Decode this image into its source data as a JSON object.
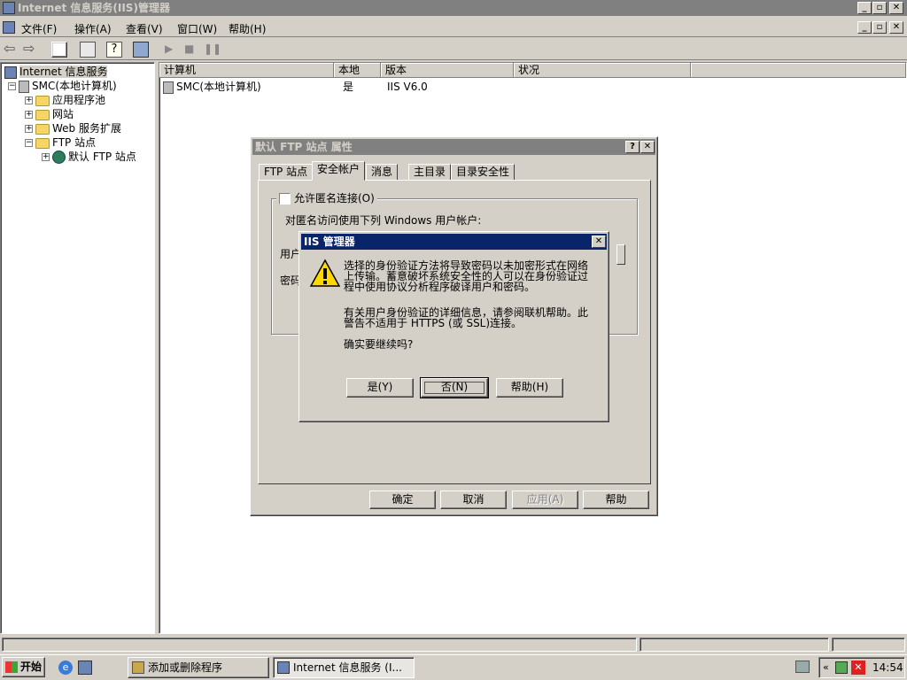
{
  "app": {
    "title": "Internet 信息服务(IIS)管理器",
    "menu": [
      "文件(F)",
      "操作(A)",
      "查看(V)",
      "窗口(W)",
      "帮助(H)"
    ]
  },
  "tree": {
    "root": "Internet 信息服务",
    "computer": "SMC(本地计算机)",
    "items": [
      "应用程序池",
      "网站",
      "Web 服务扩展",
      "FTP 站点"
    ],
    "ftp_child": "默认 FTP 站点"
  },
  "list": {
    "columns": [
      "计算机",
      "本地",
      "版本",
      "状况"
    ],
    "rows": [
      {
        "computer": "SMC(本地计算机)",
        "local": "是",
        "version": "IIS V6.0",
        "status": ""
      }
    ]
  },
  "props_dialog": {
    "title": "默认 FTP 站点 属性",
    "tabs": [
      "FTP 站点",
      "安全帐户",
      "消息",
      "主目录",
      "目录安全性"
    ],
    "allow_anonymous": "允许匿名连接(O)",
    "anon_desc": "对匿名访问使用下列 Windows 用户帐户:",
    "user_label": "用户",
    "password_label": "密码",
    "buttons": {
      "ok": "确定",
      "cancel": "取消",
      "apply": "应用(A)",
      "help": "帮助"
    }
  },
  "alert": {
    "title": "IIS 管理器",
    "msg1_line1": "选择的身份验证方法将导致密码以未加密形式在网络",
    "msg1_line2": "上传输。蓄意破坏系统安全性的人可以在身份验证过",
    "msg1_line3": "程中使用协议分析程序破译用户和密码。",
    "msg2_line1": "有关用户身份验证的详细信息，请参阅联机帮助。此",
    "msg2_line2": "警告不适用于 HTTPS (或 SSL)连接。",
    "question": "确实要继续吗?",
    "buttons": {
      "yes": "是(Y)",
      "no": "否(N)",
      "help": "帮助(H)"
    }
  },
  "taskbar": {
    "start": "开始",
    "tasks": [
      "添加或删除程序",
      "Internet 信息服务 (I..."
    ],
    "clock": "14:54"
  }
}
